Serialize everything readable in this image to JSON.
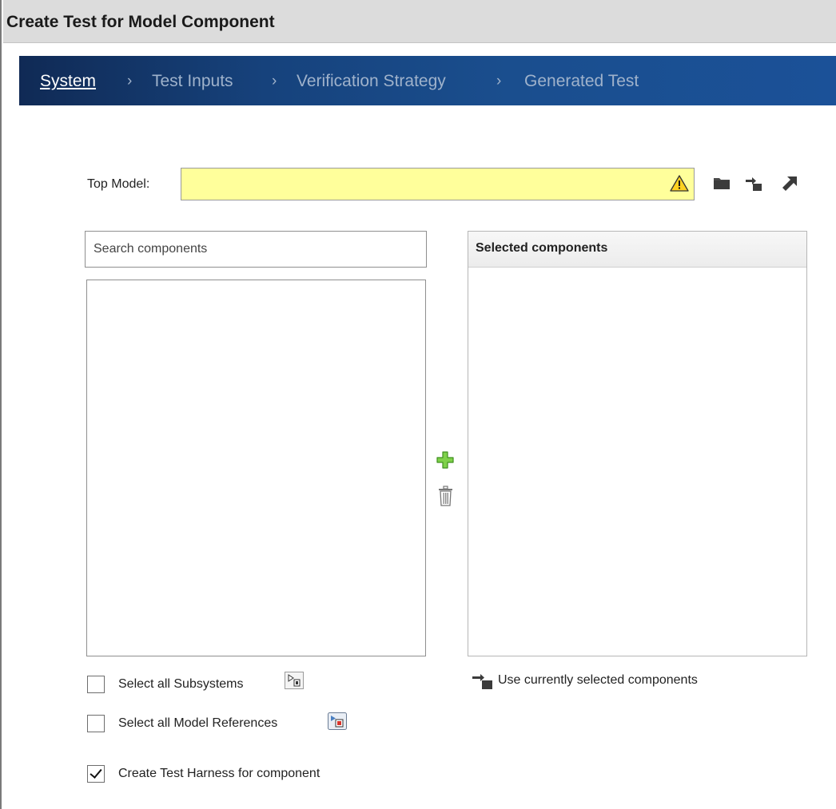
{
  "window": {
    "title": "Create Test for Model Component"
  },
  "steps": [
    {
      "label": "System",
      "active": true
    },
    {
      "label": "Test Inputs",
      "active": false
    },
    {
      "label": "Verification Strategy",
      "active": false
    },
    {
      "label": "Generated Test",
      "active": false
    }
  ],
  "step_separator": "›",
  "top_model": {
    "label": "Top Model:",
    "value": "",
    "status": "warning",
    "actions": [
      "folder-icon",
      "use-current-model-icon",
      "open-model-icon"
    ]
  },
  "search": {
    "placeholder": "Search components",
    "value": ""
  },
  "component_list": {
    "items": []
  },
  "selected_panel": {
    "header": "Selected components",
    "items": []
  },
  "list_actions": [
    "add-icon",
    "delete-icon"
  ],
  "options": {
    "select_all_subsystems": {
      "label": "Select all Subsystems",
      "checked": false,
      "icon": "subsystem-icon"
    },
    "select_all_model_refs": {
      "label": "Select all Model References",
      "checked": false,
      "icon": "model-reference-icon"
    },
    "create_harness": {
      "label": "Create Test Harness for component",
      "checked": true
    }
  },
  "use_selected": {
    "label": "Use currently selected components",
    "icon": "use-selected-icon"
  },
  "colors": {
    "title_bg": "#dcdcdc",
    "nav_bg": "#16427c",
    "nav_active": "#ffffff",
    "nav_inactive": "#9fb2cb",
    "input_warning_bg": "#ffff9b",
    "add_green": "#6cc23a"
  }
}
